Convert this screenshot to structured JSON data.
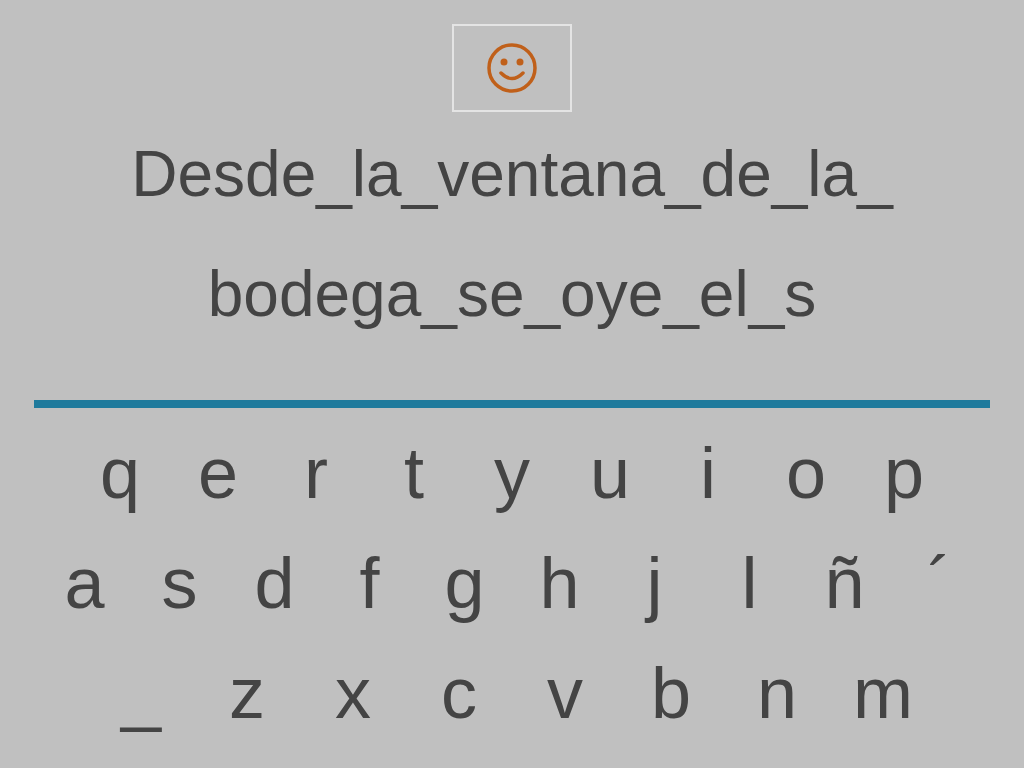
{
  "sentence_lines": [
    "Desde_la_ventana_de_la_",
    "bodega_se_oye_el_s"
  ],
  "keyboard_rows": [
    [
      "q",
      "e",
      "r",
      "t",
      "y",
      "u",
      "i",
      "o",
      "p"
    ],
    [
      "a",
      "s",
      "d",
      "f",
      "g",
      "h",
      "j",
      "l",
      "ñ",
      "´"
    ],
    [
      "_",
      "z",
      "x",
      "c",
      "v",
      "b",
      "n",
      "m"
    ]
  ]
}
